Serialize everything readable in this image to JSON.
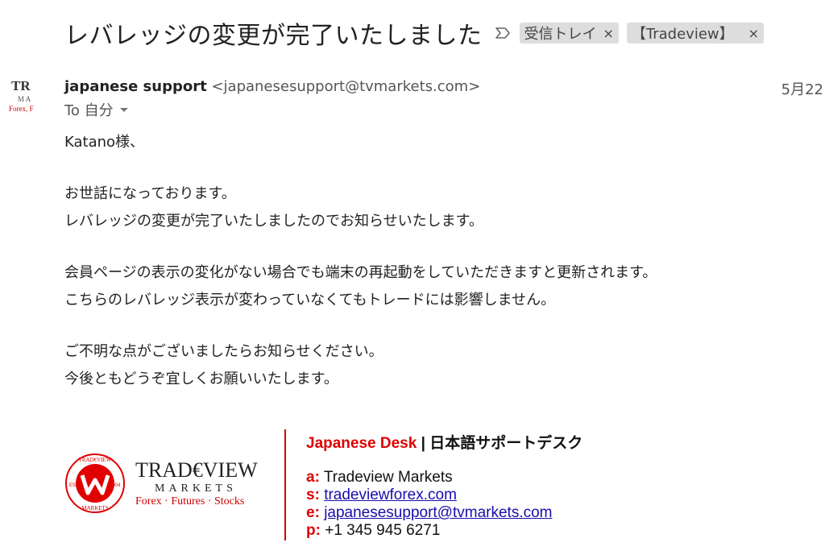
{
  "email": {
    "subject": "レバレッジの変更が完了いたしました",
    "labels": [
      {
        "text": "受信トレイ",
        "close": "×"
      },
      {
        "text": "【Tradeview】",
        "close": "×"
      }
    ],
    "sender": {
      "name": "japanese support",
      "email": "<japanesesupport@tvmarkets.com>"
    },
    "to": "To 自分",
    "date": "5月22",
    "avatar": {
      "line1": "TR",
      "line2": "M  A",
      "line3": "Forex, F"
    },
    "body": {
      "greeting": "Katano様、",
      "p1_l1": "お世話になっております。",
      "p1_l2": "レバレッジの変更が完了いたしましたのでお知らせいたします。",
      "p2_l1": "会員ページの表示の変化がない場合でも端末の再起動をしていただきますと更新されます。",
      "p2_l2": "こちらのレバレッジ表示が変わっていなくてもトレードには影響しません。",
      "p3_l1": "ご不明な点がございましたらお知らせください。",
      "p3_l2": "今後ともどうぞ宜しくお願いいたします。"
    }
  },
  "signature": {
    "title_red": "Japanese Desk",
    "title_rest": " | 日本語サポートデスク",
    "logo": {
      "brand_top": "TRAD€VIEW",
      "brand_mid": "MARKETS",
      "brand_bottom": "Forex · Futures · Stocks",
      "ring_top": "TRAD€VIEW",
      "ring_bottom": "MARKETS",
      "est": "EST.",
      "year": "2004"
    },
    "rows": [
      {
        "key": "a:",
        "value": "Tradeview Markets",
        "link": false
      },
      {
        "key": "s:",
        "value": "tradeviewforex.com",
        "link": true
      },
      {
        "key": "e:",
        "value": "japanesesupport@tvmarkets.com",
        "link": true
      },
      {
        "key": "p:",
        "value": "+1 345 945 6271",
        "link": false
      }
    ]
  },
  "colors": {
    "brand_red": "#e00000",
    "link": "#1a0dab",
    "chip_bg": "#dddddd"
  }
}
